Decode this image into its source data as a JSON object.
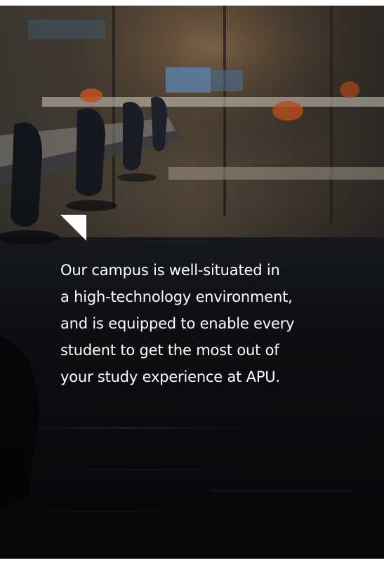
{
  "card": {
    "caption_lines": [
      "Our campus is well-situated in",
      "a high-technology environment,",
      "and is equipped to enable every",
      "student to get the most out of",
      "your study experience at APU."
    ]
  }
}
